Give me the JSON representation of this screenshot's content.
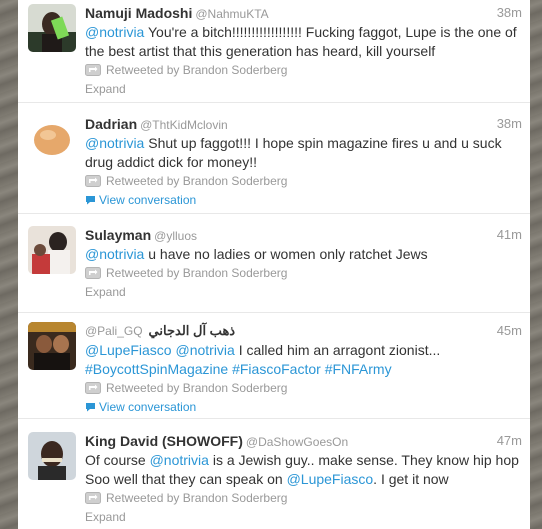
{
  "retweet_label": "Retweeted by Brandon Soderberg",
  "tweets": [
    {
      "fullname": "Namuji Madoshi",
      "screenname": "@NahmuKTA",
      "time": "38m",
      "parts": [
        {
          "type": "mention",
          "text": "@notrivia"
        },
        {
          "type": "text",
          "text": " You're a bitch!!!!!!!!!!!!!!!!!! Fucking faggot, Lupe is the one of the best artist that this generation has heard, kill yourself"
        }
      ],
      "action": "Expand"
    },
    {
      "fullname": "Dadrian",
      "screenname": "@ThtKidMclovin",
      "time": "38m",
      "parts": [
        {
          "type": "mention",
          "text": "@notrivia"
        },
        {
          "type": "text",
          "text": " Shut up faggot!!! I hope spin magazine fires u and u suck drug addict dick for money!!"
        }
      ],
      "action": "View conversation"
    },
    {
      "fullname": "Sulayman",
      "screenname": "@ylluos",
      "time": "41m",
      "parts": [
        {
          "type": "mention",
          "text": "@notrivia"
        },
        {
          "type": "text",
          "text": " u have no ladies or women only ratchet Jews"
        }
      ],
      "action": "Expand"
    },
    {
      "fullname": "ذهب آل الدجاني",
      "screenname": "@Pali_GQ",
      "time": "45m",
      "parts": [
        {
          "type": "mention",
          "text": "@LupeFiasco"
        },
        {
          "type": "text",
          "text": " "
        },
        {
          "type": "mention",
          "text": "@notrivia"
        },
        {
          "type": "text",
          "text": " I called him an arragont zionist... "
        },
        {
          "type": "hashtag",
          "text": "#BoycottSpinMagazine"
        },
        {
          "type": "text",
          "text": " "
        },
        {
          "type": "hashtag",
          "text": "#FiascoFactor"
        },
        {
          "type": "text",
          "text": " "
        },
        {
          "type": "hashtag",
          "text": "#FNFArmy"
        }
      ],
      "action": "View conversation"
    },
    {
      "fullname": "King David (SHOWOFF)",
      "screenname": "@DaShowGoesOn",
      "time": "47m",
      "parts": [
        {
          "type": "text",
          "text": "Of course "
        },
        {
          "type": "mention",
          "text": "@notrivia"
        },
        {
          "type": "text",
          "text": " is a Jewish guy.. make sense. They know hip hop Soo well that they can speak on "
        },
        {
          "type": "mention",
          "text": "@LupeFiasco"
        },
        {
          "type": "text",
          "text": ". I get it now"
        }
      ],
      "action": "Expand"
    }
  ],
  "colors": {
    "link": "#2b96d6",
    "meta": "#999999",
    "text": "#333333"
  },
  "icons": {
    "retweet": "retweet-icon",
    "conversation": "speech-bubble-icon"
  }
}
